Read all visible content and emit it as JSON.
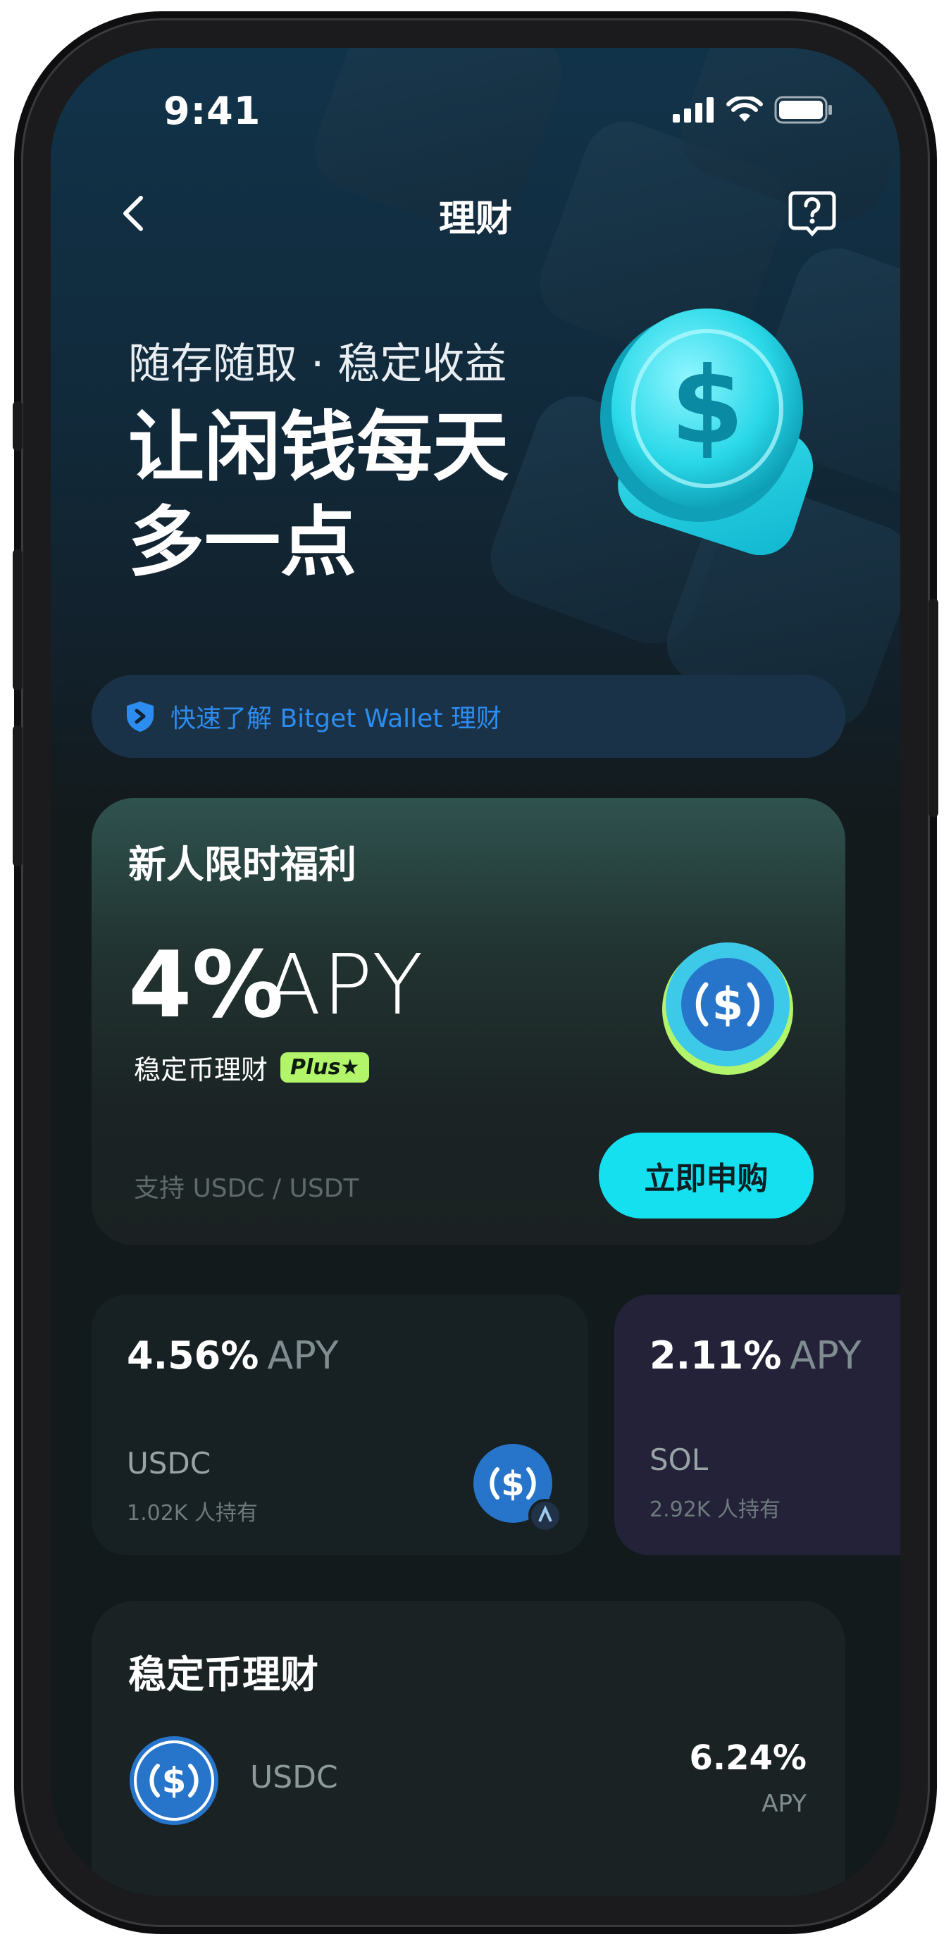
{
  "status_bar": {
    "time": "9:41"
  },
  "nav": {
    "title": "理财"
  },
  "hero": {
    "subtitle": "随存随取 · 稳定收益",
    "title_line1": "让闲钱每天",
    "title_line2": "多一点"
  },
  "learn_banner": {
    "text": "快速了解 Bitget Wallet 理财"
  },
  "promo": {
    "title": "新人限时福利",
    "rate": "4%",
    "apy_label": "APY",
    "product_label": "稳定币理财",
    "badge": "Plus",
    "support_text": "支持 USDC / USDT",
    "button_label": "立即申购"
  },
  "mini_cards": [
    {
      "rate": "4.56%",
      "apy_label": "APY",
      "token": "USDC",
      "holders": "1.02K 人持有"
    },
    {
      "rate": "2.11%",
      "apy_label": "APY",
      "token": "SOL",
      "holders": "2.92K 人持有"
    }
  ],
  "stablecoin_section": {
    "title": "稳定币理财",
    "items": [
      {
        "token": "USDC",
        "rate": "6.24%",
        "apy_label": "APY"
      }
    ]
  },
  "colors": {
    "accent_cyan": "#14e0ef",
    "link_blue": "#2d8cf0",
    "plus_green": "#b2f46a",
    "usdc_blue": "#2775ca"
  },
  "icons": {
    "back": "chevron-left-icon",
    "help": "question-bubble-icon",
    "shield": "shield-icon",
    "usdc": "usdc-coin-icon"
  }
}
